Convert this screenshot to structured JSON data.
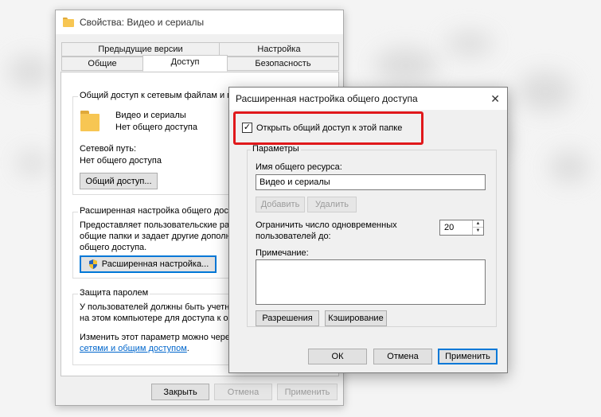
{
  "properties_window": {
    "title": "Свойства: Видео и сериалы",
    "tabs": [
      "Предыдущие версии",
      "Настройка",
      "Общие",
      "Доступ",
      "Безопасность"
    ],
    "network_share": {
      "group_title": "Общий доступ к сетевым файлам и папкам",
      "folder_name": "Видео и сериалы",
      "folder_status": "Нет общего доступа",
      "path_label": "Сетевой путь:",
      "path_value": "Нет общего доступа",
      "share_button": "Общий доступ..."
    },
    "advanced_sharing": {
      "group_title": "Расширенная настройка общего досту",
      "description_lines": [
        "Предоставляет пользовательские ра",
        "общие папки и задает другие дополн",
        "общего доступа."
      ],
      "button": "Расширенная настройка..."
    },
    "password_protection": {
      "group_title": "Защита паролем",
      "lines": [
        "У пользователей должны быть учетн",
        "на этом компьютере для доступа к о"
      ],
      "change_text": "Изменить этот параметр можно чере",
      "link": "сетями и общим доступом",
      "link_suffix": "."
    },
    "buttons": {
      "close": "Закрыть",
      "cancel": "Отмена",
      "apply": "Применить"
    }
  },
  "advanced_dialog": {
    "title": "Расширенная настройка общего доступа",
    "close_glyph": "✕",
    "share_checkbox": {
      "label": "Открыть общий доступ к этой папке",
      "checked": true,
      "glyph": "✓"
    },
    "settings_group": "Параметры",
    "share_name_label": "Имя общего ресурса:",
    "share_name_value": "Видео и сериалы",
    "add_button": "Добавить",
    "remove_button": "Удалить",
    "limit_label_line1": "Ограничить число одновременных",
    "limit_label_line2": "пользователей до:",
    "limit_value": "20",
    "comment_label": "Примечание:",
    "comment_value": "",
    "permissions_button": "Разрешения",
    "caching_button": "Кэширование",
    "ok_button": "ОК",
    "cancel_button": "Отмена",
    "apply_button": "Применить"
  },
  "colors": {
    "highlight_border": "#e0181b",
    "link": "#0066cc",
    "default_button_border": "#0078d7",
    "folder": "#f7c653"
  },
  "icons": {
    "folder": "folder-icon",
    "shield": "uac-shield-icon",
    "spin_up": "▲",
    "spin_down": "▼"
  }
}
